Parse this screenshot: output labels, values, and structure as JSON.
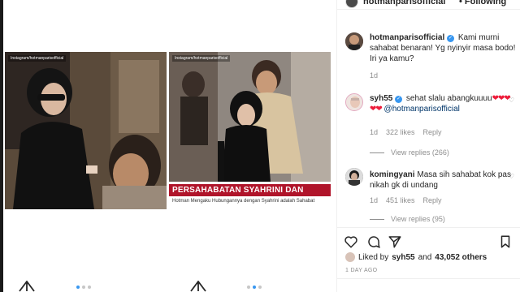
{
  "post": {
    "photos": [
      {
        "watermark": "Instagram/hotmanparisofficial"
      },
      {
        "watermark": "Instagram/hotmanparisofficial",
        "banner_title": "PERSAHABATAN SYAHRINI DAN HOTMAN PARIS",
        "banner_sub": "Hotman Mengaku Hubungannya dengan Syahrini adalah Sahabat"
      }
    ]
  },
  "header": {
    "username": "hotmanparisofficial",
    "follow_label": "• Following"
  },
  "comments": [
    {
      "username": "hotmanparisofficial",
      "text": "Kami murni sahabat benaran! Yg nyinyir masa bodo! Iri ya kamu?",
      "time": "1d"
    },
    {
      "username": "syh55",
      "text_before": "sehat slalu abangkuuuu",
      "hearts": "❤❤❤❤❤",
      "mention": "@hotmanparisofficial",
      "time": "1d",
      "likes": "322 likes",
      "reply": "Reply",
      "view_replies": "View replies (266)"
    },
    {
      "username": "komingyani",
      "text": "Masa sih sahabat kok pas nikah gk di undang",
      "time": "1d",
      "likes": "451 likes",
      "reply": "Reply",
      "view_replies": "View replies (95)"
    }
  ],
  "likes_row": {
    "prefix": "Liked by",
    "user": "syh55",
    "and": "and",
    "others": "43,052 others"
  },
  "timestamp": "1 DAY AGO",
  "colors": {
    "accent": "#3897f0",
    "banner_red": "#b0142a",
    "heart_red": "#ed1c3a",
    "muted": "#8e8e8e"
  }
}
